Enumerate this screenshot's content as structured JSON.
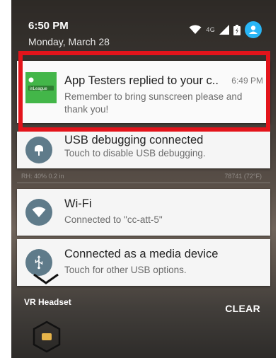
{
  "status_bar": {
    "time": "6:50 PM",
    "date": "Monday, March 28",
    "network": "4G"
  },
  "background": {
    "weather": "RH: 40%  0.2 in",
    "temp": "78741 (72°F)",
    "vr_label": "VR Headset"
  },
  "notifications": [
    {
      "app": "InLeague",
      "title": "App Testers replied to your c..",
      "time": "6:49 PM",
      "text": "Remember to bring sunscreen please and thank you!"
    },
    {
      "title": "USB debugging connected",
      "text": "Touch to disable USB debugging."
    },
    {
      "title": "Wi-Fi",
      "text": "Connected to \"cc-att-5\""
    },
    {
      "title": "Connected as a media device",
      "text": "Touch for other USB options."
    }
  ],
  "clear_label": "CLEAR",
  "colors": {
    "highlight": "#e3141b",
    "app_icon": "#43b649",
    "system_icon": "#5f7b8a",
    "account": "#29b6f6"
  }
}
